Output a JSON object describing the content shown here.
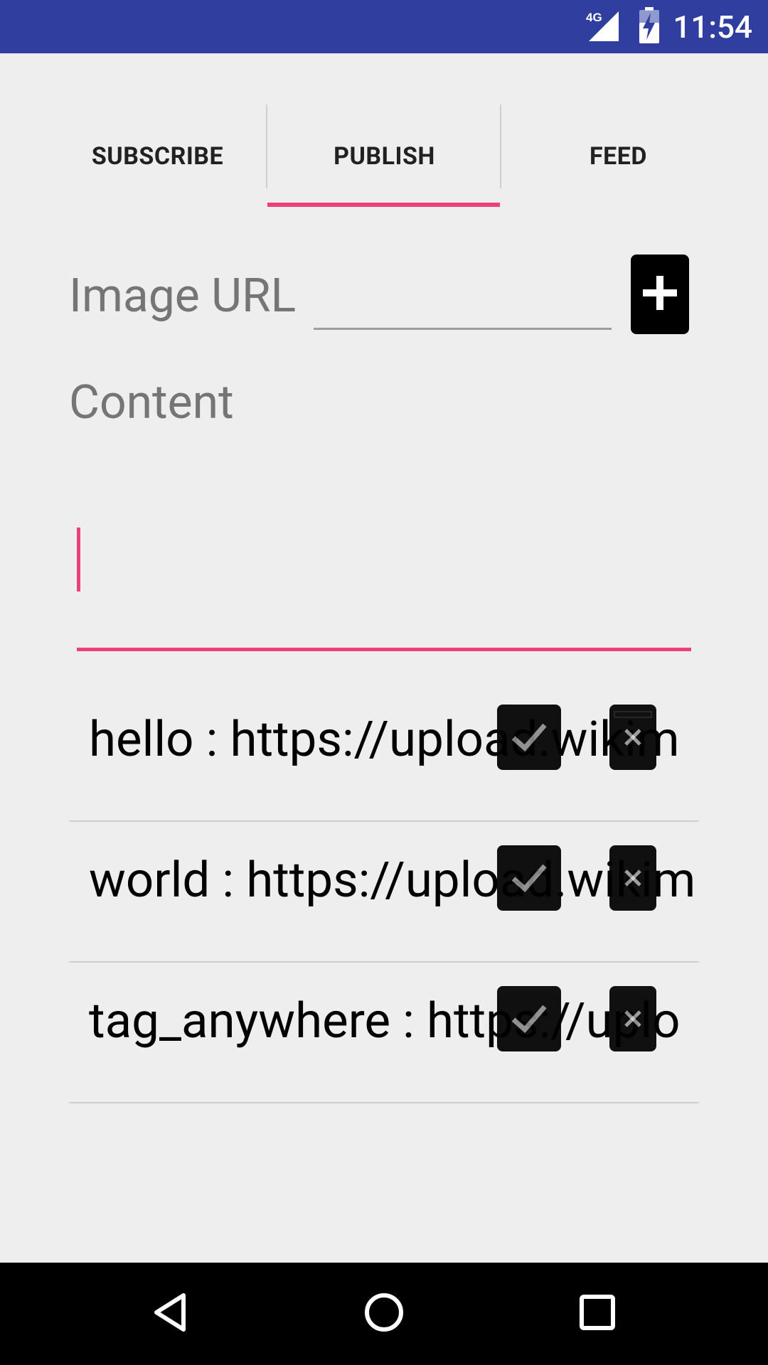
{
  "status_bar": {
    "network": "4G",
    "time": "11:54"
  },
  "tabs": [
    {
      "label": "SUBSCRIBE",
      "selected": false
    },
    {
      "label": "PUBLISH",
      "selected": true
    },
    {
      "label": "FEED",
      "selected": false
    }
  ],
  "form": {
    "image_url_label": "Image URL",
    "image_url_value": "",
    "content_label": "Content",
    "content_value": ""
  },
  "entries": [
    {
      "text": "hello : https://upload.wikim"
    },
    {
      "text": "world : https://upload.wikim"
    },
    {
      "text": "tag_anywhere : https://uplo"
    }
  ],
  "colors": {
    "status_bar": "#303f9f",
    "accent": "#ec407a",
    "background": "#eeeeee"
  },
  "icons": {
    "add": "plus-icon",
    "check": "checkbox-icon",
    "delete": "trash-icon"
  }
}
